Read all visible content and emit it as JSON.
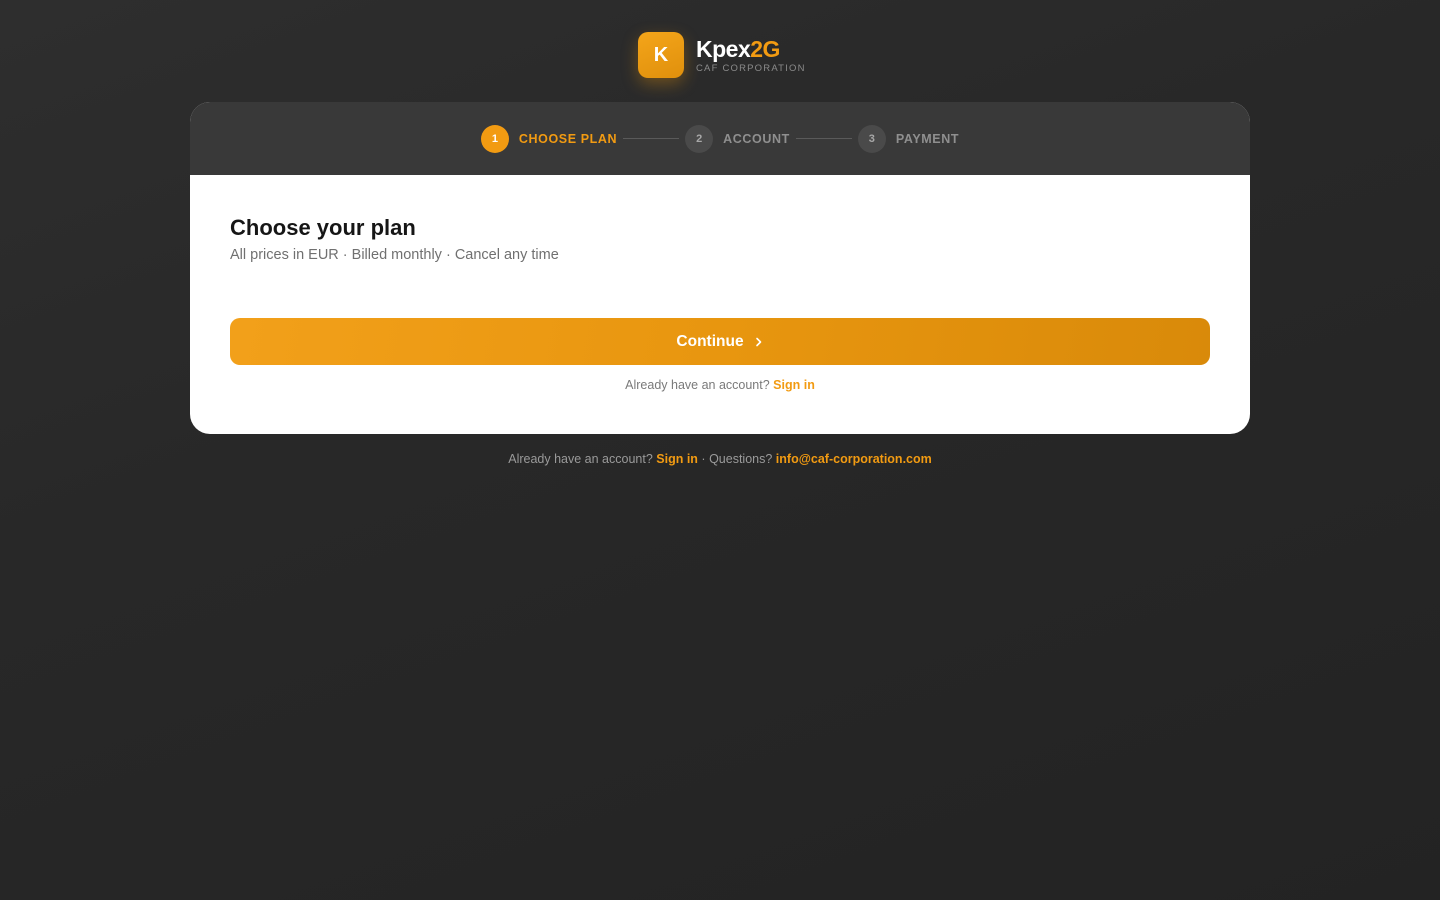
{
  "brand": {
    "logo_letter": "K",
    "name_main": "Kpex",
    "name_accent": "2G",
    "subtitle": "CAF CORPORATION"
  },
  "stepper": {
    "steps": [
      {
        "number": "1",
        "label": "CHOOSE PLAN",
        "state": "active"
      },
      {
        "number": "2",
        "label": "ACCOUNT",
        "state": "inactive"
      },
      {
        "number": "3",
        "label": "PAYMENT",
        "state": "inactive"
      }
    ]
  },
  "main": {
    "title": "Choose your plan",
    "subtitle": "All prices in EUR · Billed monthly · Cancel any time",
    "continue_label": "Continue",
    "continue_icon": "chevron-right-icon",
    "account_prompt": "Already have an account?",
    "sign_in_label": "Sign in"
  },
  "footer": {
    "account_prompt": "Already have an account?",
    "sign_in_label": "Sign in",
    "separator": "·",
    "questions_label": "Questions?",
    "email": "info@caf-corporation.com"
  },
  "colors": {
    "accent": "#f29b12",
    "background": "#2a2a2a",
    "stepper_bg": "#393939",
    "card_bg": "#ffffff"
  }
}
